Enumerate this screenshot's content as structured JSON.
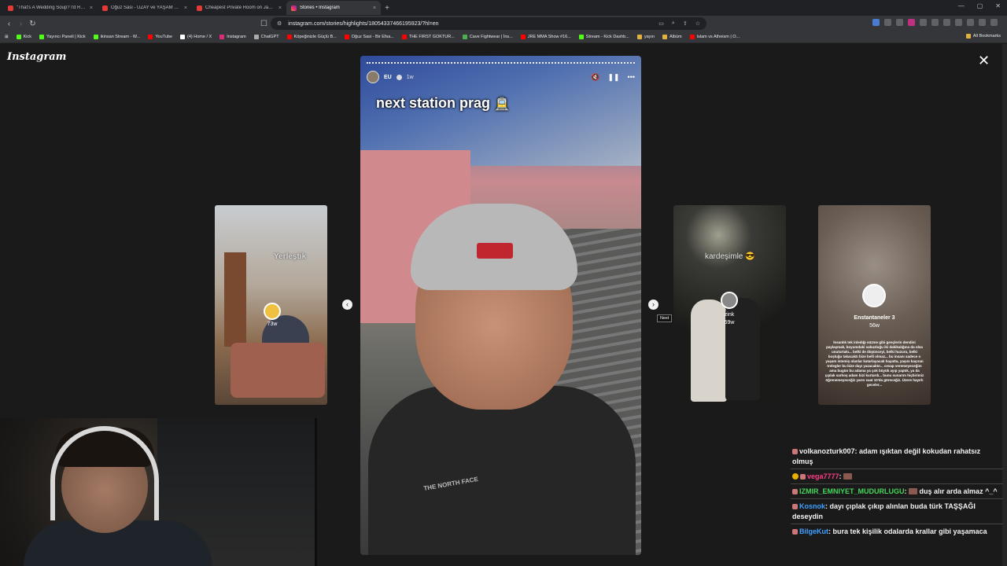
{
  "browser": {
    "tabs": [
      {
        "title": "\"That's A Wedding Soup? I'd Rather",
        "active": false
      },
      {
        "title": "Oğuz Sasi - UZAY ve YAŞAM Teorileri",
        "active": false
      },
      {
        "title": "Cheapest Private Room on Japan's O",
        "active": false
      },
      {
        "title": "Stories • Instagram",
        "active": true
      }
    ],
    "url": "instagram.com/stories/highlights/18054337466195923/?hl=en",
    "bookmarks": [
      "Kick",
      "Yayıncı Paneli | Kick",
      "ikinsan Stream - W...",
      "YouTube",
      "(4) Home / X",
      "Instagram",
      "ChatGPT",
      "Köpeğinizle Güçlü B...",
      "Oğuz Sasi - Bir Efsa...",
      "THE FIRST GOKTUR...",
      "Cave Fightwear | İns...",
      "JRE MMA Show #16...",
      "Stream - Kick Dashb...",
      "yayın",
      "Albüm",
      "Islam vs Atheism | O..."
    ],
    "all_bookmarks": "All Bookmarks"
  },
  "instagram": {
    "logo": "Instagram",
    "main_story": {
      "username": "EU",
      "time": "1w",
      "caption": "next station prag",
      "caption_emoji": "🚊",
      "brand_text": "THE NORTH FACE"
    },
    "side_stories": [
      {
        "label": "Yerleştik",
        "username": "",
        "time": "73w",
        "avatar_emoji": "🫠"
      },
      {
        "label": "kardeşimle 😎",
        "username": "zink",
        "time": "59w"
      },
      {
        "label": "",
        "username": "Enstantaneler 3",
        "time": "56w",
        "text": "İnsanlık tek inledığı süzme gibi gençlerin dendini paylaşmak, boyumdaki sabuzluğu iki dakikalığına da olsa unuturtakı... belki de düşünceyi, belki huzuru, belki boşluğu takacaktı bize belli olmaz... bu insanı sadece o yaşam istemiş olanlar katarlayacak hayatta, yaşını kaçıran trelegler bu bize dayı yazacaktır... cevap veremeyeceğim ama bugün bu adama ya çok büyük ayıp yaptık, ya da çıplak sarhoş adam bizi kurtardı... bunu sunarım hiçbirimiz öğrenemeyeceğiz yarın saat 10'da göreceğiz. Üzere hayırlı geceler..."
      }
    ],
    "next_tooltip": "Next"
  },
  "chat": [
    {
      "user": "volkanozturk007",
      "color": "#f2f2f2",
      "text": "adam ışıktan değil kokudan rahatsız olmuş",
      "badge": "pink"
    },
    {
      "user": "vega7777",
      "color": "#ff3c8a",
      "text": "",
      "badge": "gold",
      "emote": true
    },
    {
      "user": "IZMIR_EMNIYET_MUDURLUGU",
      "color": "#45d65a",
      "text": "duş alır arda almaz ^_^",
      "badge": "pink"
    },
    {
      "user": "Kosnok",
      "color": "#3fa0ff",
      "text": "dayı çıplak çıkıp alınlan buda türk TAŞŞAĞI deseydin",
      "badge": "pink"
    },
    {
      "user": "BilgeKut",
      "color": "#3fa0ff",
      "text": "bura tek kişilik odalarda krallar gibi yaşamaca",
      "badge": "pink"
    }
  ]
}
